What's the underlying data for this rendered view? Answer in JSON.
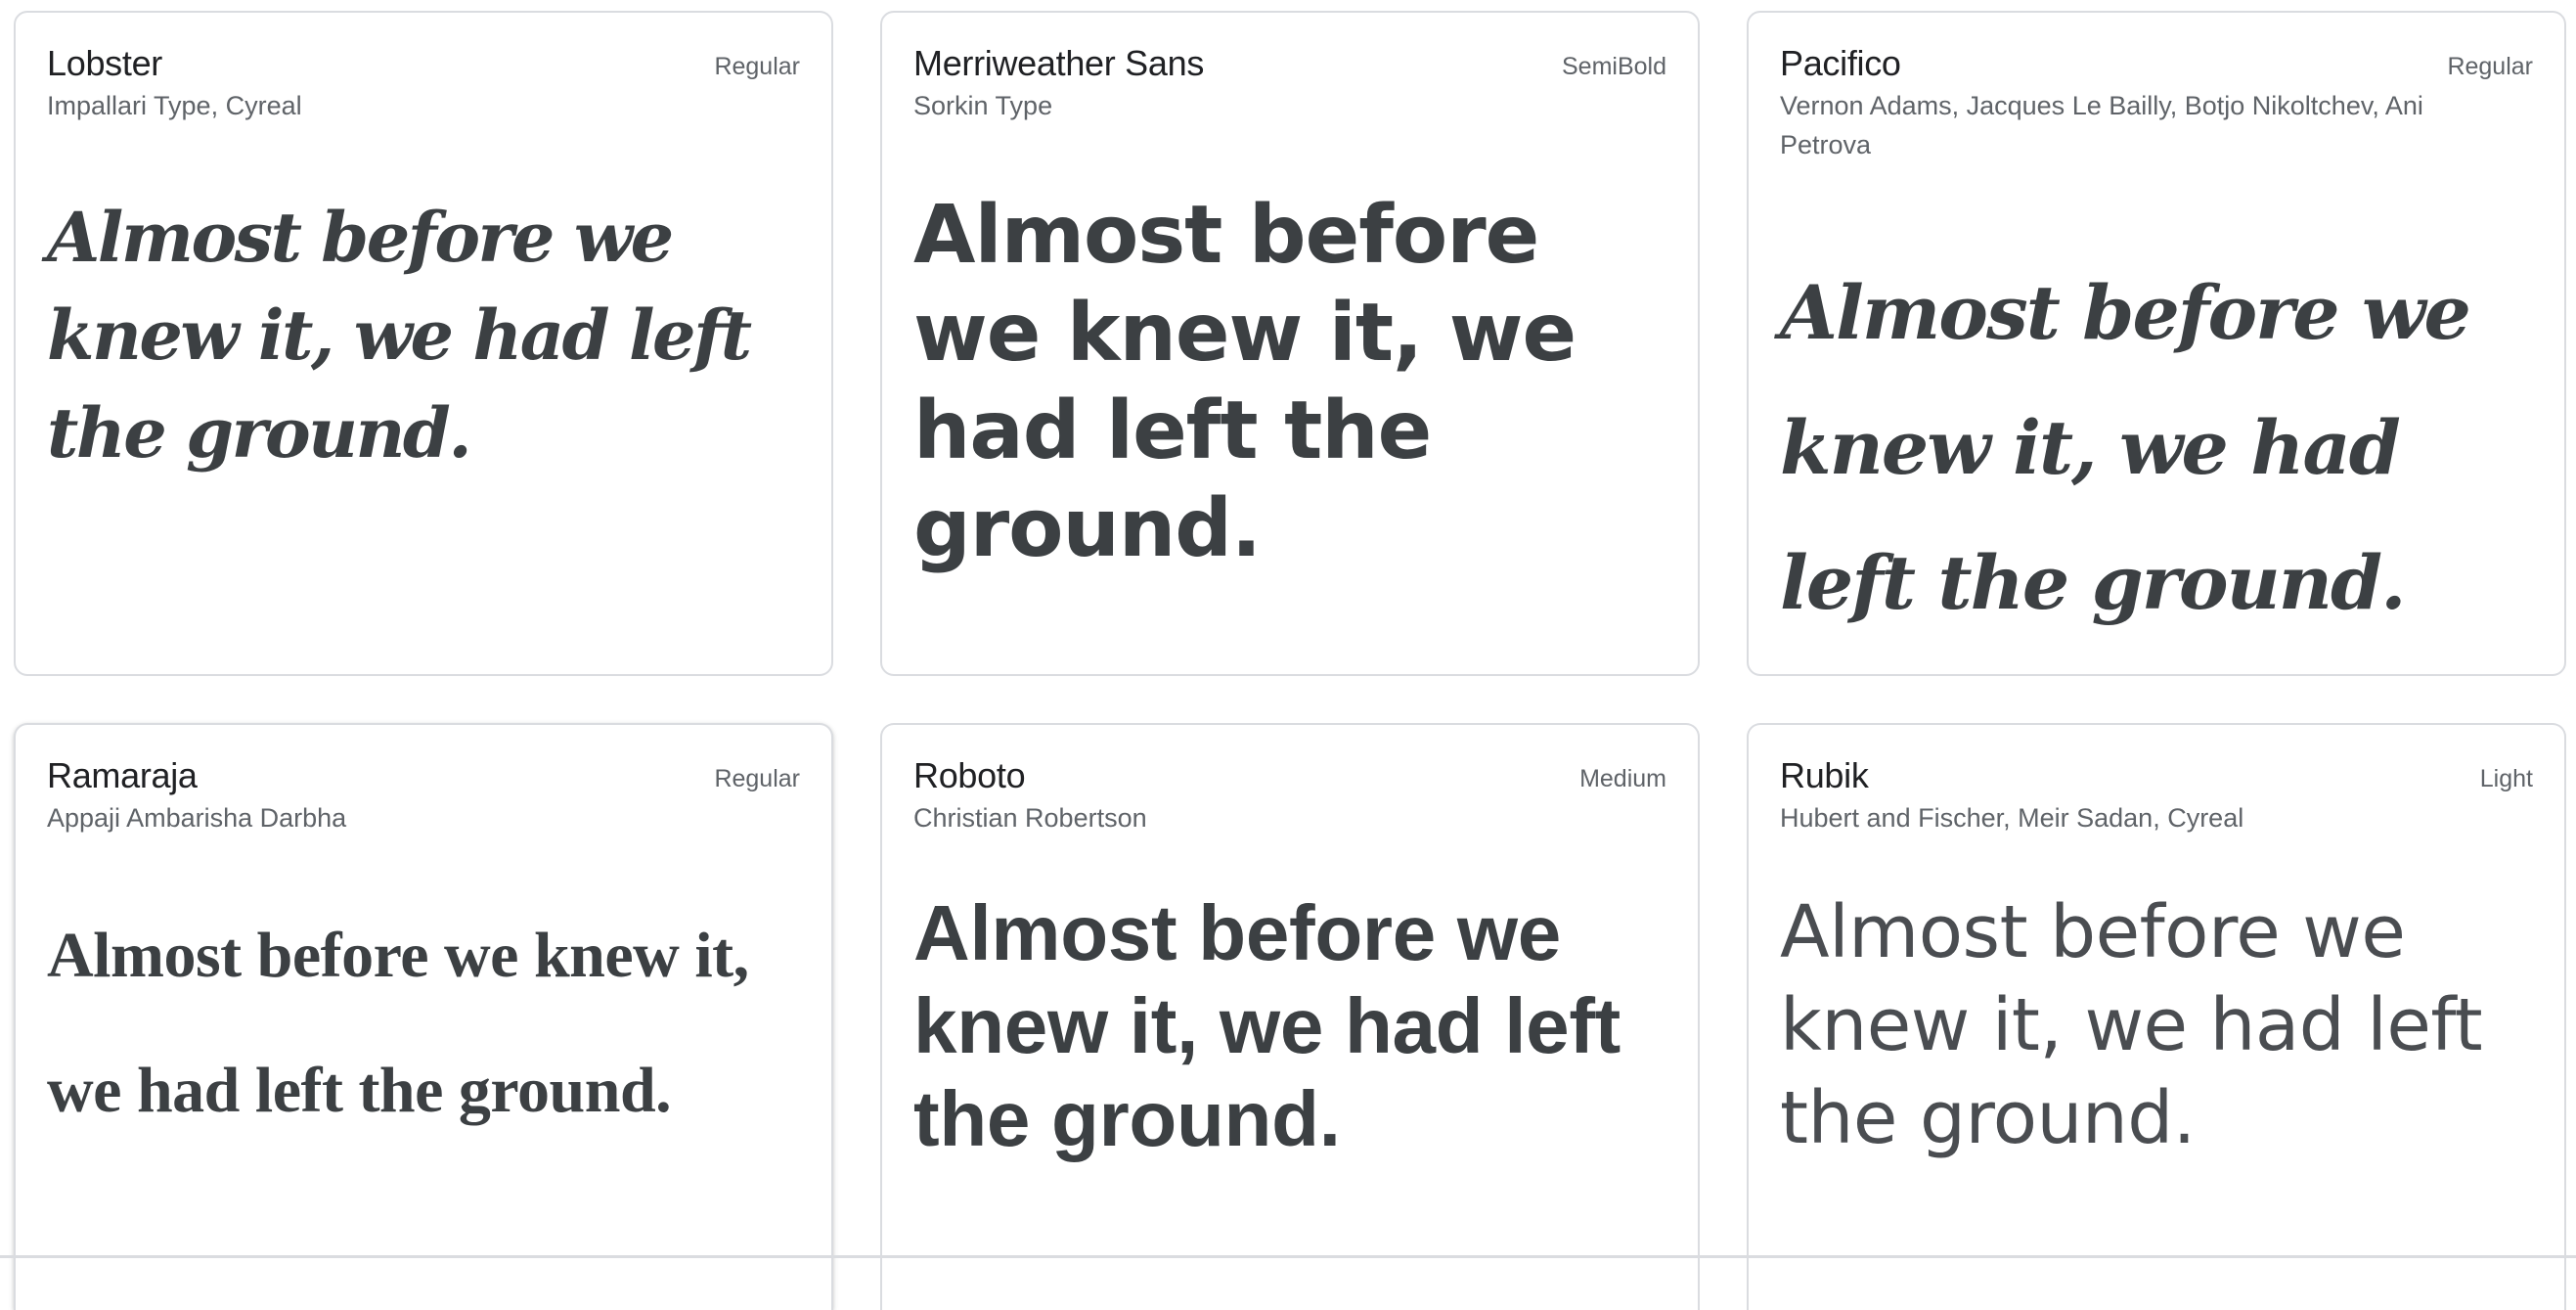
{
  "sample_text": "Almost before we knew it, we had left the ground.",
  "fonts": [
    {
      "family": "Lobster",
      "style": "Regular",
      "designers": "Impallari Type, Cyreal"
    },
    {
      "family": "Merriweather Sans",
      "style": "SemiBold",
      "designers": "Sorkin Type"
    },
    {
      "family": "Pacifico",
      "style": "Regular",
      "designers": "Vernon Adams, Jacques Le Bailly, Botjo Nikoltchev, Ani Petrova"
    },
    {
      "family": "Ramaraja",
      "style": "Regular",
      "designers": "Appaji Ambarisha Darbha"
    },
    {
      "family": "Roboto",
      "style": "Medium",
      "designers": "Christian Robertson"
    },
    {
      "family": "Rubik",
      "style": "Light",
      "designers": "Hubert and Fischer, Meir Sadan, Cyreal"
    }
  ],
  "colors": {
    "card_border": "#dadce0",
    "name_text": "#202124",
    "meta_text": "#5f6368",
    "sample_text": "#3c4043"
  }
}
